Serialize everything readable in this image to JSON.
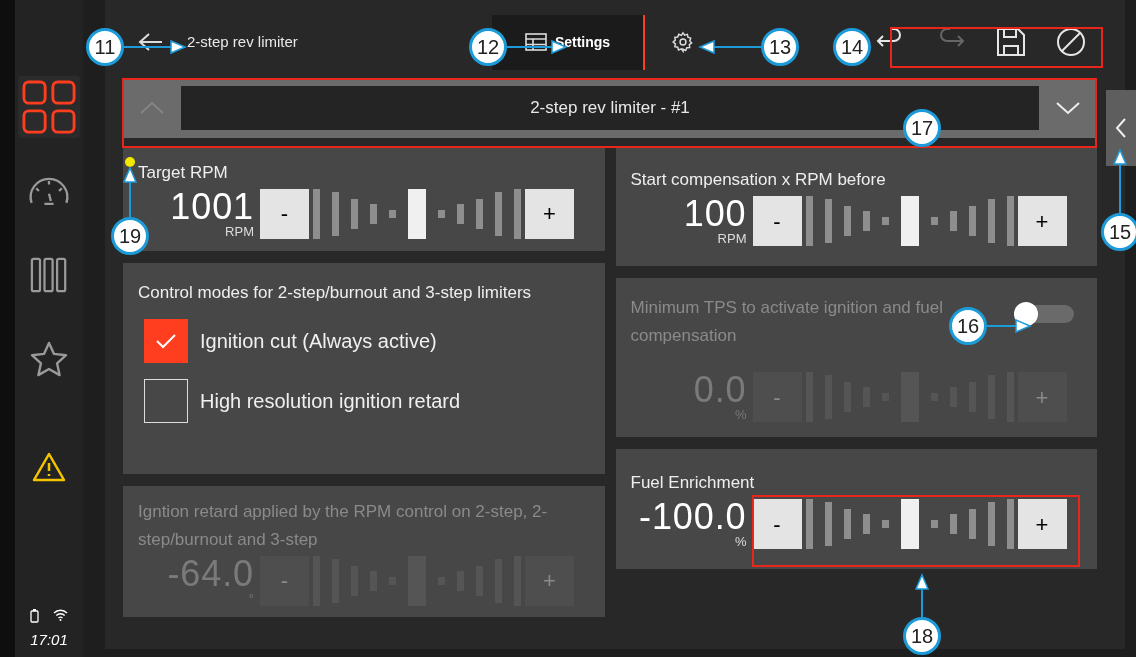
{
  "sidebar": {
    "items": [
      {
        "kind": "grid",
        "selected": true
      },
      {
        "kind": "gauge",
        "selected": false
      },
      {
        "kind": "columns",
        "selected": false
      },
      {
        "kind": "star",
        "selected": false
      }
    ],
    "time": "17:01"
  },
  "header": {
    "title": "2-step rev limiter",
    "tabs": [
      {
        "kind": "table",
        "label": "Settings",
        "selected": true
      },
      {
        "kind": "gear",
        "selected": false
      }
    ],
    "tools": [
      {
        "kind": "undo",
        "disabled": false
      },
      {
        "kind": "redo",
        "disabled": true
      },
      {
        "kind": "save",
        "disabled": false
      },
      {
        "kind": "cancel",
        "disabled": false
      }
    ]
  },
  "selector": {
    "value": "2-step rev limiter - #1",
    "up_disabled": true,
    "down_disabled": false
  },
  "left_cards": [
    {
      "kind": "stepper",
      "title": "Target RPM",
      "value": "1001",
      "unit": "RPM",
      "decrease": "-",
      "increase": "+",
      "disabled": false
    },
    {
      "kind": "options",
      "title": "Control modes for 2-step/burnout and 3-step limiters",
      "options": [
        {
          "label": "Ignition cut (Always active)",
          "checked": true
        },
        {
          "label": "High resolution ignition retard",
          "checked": false
        }
      ]
    },
    {
      "kind": "stepper",
      "title": "Igntion retard applied by the RPM control on 2-step, 2-step/burnout and 3-step",
      "value": "-64.0",
      "unit": "°",
      "decrease": "-",
      "increase": "+",
      "disabled": true
    }
  ],
  "right_cards": [
    {
      "kind": "stepper",
      "title": "Start compensation x RPM before",
      "value": "100",
      "unit": "RPM",
      "decrease": "-",
      "increase": "+",
      "disabled": false
    },
    {
      "kind": "toggle_stepper",
      "title": "Minimum TPS to activate ignition and fuel compensation",
      "on": false,
      "value": "0.0",
      "unit": "%",
      "decrease": "-",
      "increase": "+",
      "disabled": true
    },
    {
      "kind": "stepper",
      "title": "Fuel Enrichment",
      "value": "-100.0",
      "unit": "%",
      "decrease": "-",
      "increase": "+",
      "disabled": false
    }
  ],
  "callouts": [
    {
      "number": "11"
    },
    {
      "number": "12"
    },
    {
      "number": "13"
    },
    {
      "number": "14"
    },
    {
      "number": "15"
    },
    {
      "number": "16"
    },
    {
      "number": "17"
    },
    {
      "number": "18"
    },
    {
      "number": "19"
    }
  ]
}
